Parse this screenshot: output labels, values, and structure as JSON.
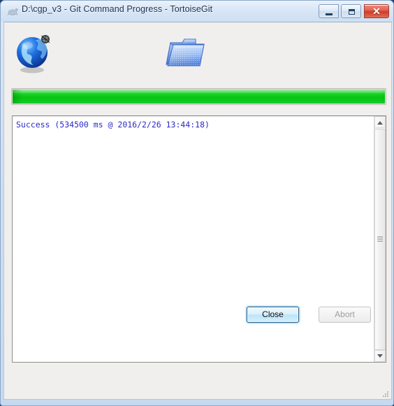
{
  "window": {
    "title": "D:\\cgp_v3 - Git Command Progress - TortoiseGit",
    "title_icon": "tortoisegit-turtle-icon",
    "frame_color": "#c6d9ef",
    "client_bg": "#f0efed",
    "controls": {
      "minimize_label": "",
      "maximize_label": "",
      "close_label": "✕",
      "minimize_name": "minimize-button",
      "maximize_name": "restore-button",
      "close_name": "close-window-button"
    }
  },
  "icons": {
    "source_icon": "globe-network-icon",
    "target_icon": "folder-icon"
  },
  "progress": {
    "percent": 100,
    "percent_label": "100%",
    "fill_color": "#07c313",
    "track_color": "#ecebe9"
  },
  "log": {
    "lines": [
      "Success (534500 ms @ 2016/2/26 13:44:18)"
    ],
    "text": "Success (534500 ms @ 2016/2/26 13:44:18)",
    "text_color": "#2b2bc8",
    "background": "#ffffff"
  },
  "scrollbar": {
    "up_arrow": "▲",
    "down_arrow": "▼",
    "thumb_name": "vertical-scrollbar-thumb"
  },
  "footer": {
    "close_label": "Close",
    "abort_label": "Abort",
    "abort_disabled": true,
    "close_is_default": true
  }
}
